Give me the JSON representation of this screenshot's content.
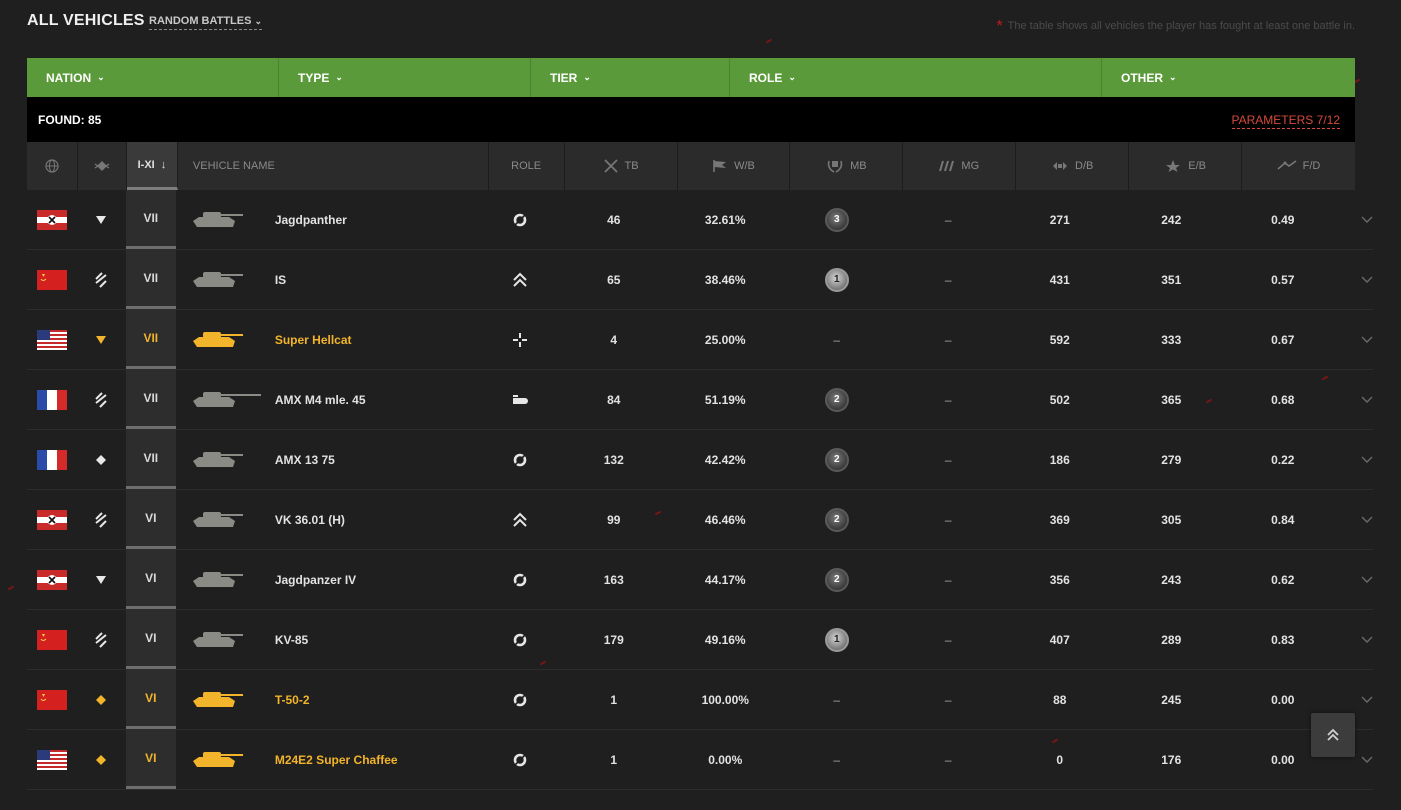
{
  "header": {
    "title": "ALL VEHICLES",
    "mode": "RANDOM BATTLES",
    "note": "The table shows all vehicles the player has fought at least one battle in."
  },
  "filters": [
    {
      "label": "NATION"
    },
    {
      "label": "TYPE"
    },
    {
      "label": "TIER"
    },
    {
      "label": "ROLE"
    },
    {
      "label": "OTHER"
    }
  ],
  "found": {
    "label": "FOUND: 85"
  },
  "params": {
    "label": "PARAMETERS 7/12"
  },
  "columns": {
    "tier": "I-XI",
    "name": "VEHICLE NAME",
    "role": "ROLE",
    "tb": "TB",
    "wb": "W/B",
    "mb": "MB",
    "mg": "MG",
    "db": "D/B",
    "eb": "E/B",
    "fd": "F/D"
  },
  "colors": {
    "filter_bar": "#5b9a3a",
    "premium": "#f2b42a",
    "params_link": "#d54a3a"
  },
  "rows": [
    {
      "nation": "germany",
      "type": "td-icon",
      "tier": "VII",
      "name": "Jagdpanther",
      "premium": false,
      "role": "sniper-role-icon",
      "tb": "46",
      "wb": "32.61%",
      "mb": "3",
      "mb_style": "bronze",
      "mg": "–",
      "db": "271",
      "eb": "242",
      "fd": "0.49"
    },
    {
      "nation": "ussr",
      "type": "heavy-icon",
      "tier": "VII",
      "name": "IS",
      "premium": false,
      "role": "assault-role-icon",
      "tb": "65",
      "wb": "38.46%",
      "mb": "1",
      "mb_style": "silver",
      "mg": "–",
      "db": "431",
      "eb": "351",
      "fd": "0.57"
    },
    {
      "nation": "usa",
      "type": "td-icon",
      "tier": "VII",
      "name": "Super Hellcat",
      "premium": true,
      "role": "crosshair-role-icon",
      "tb": "4",
      "wb": "25.00%",
      "mb": "–",
      "mb_style": "none",
      "mg": "–",
      "db": "592",
      "eb": "333",
      "fd": "0.67"
    },
    {
      "nation": "france",
      "type": "heavy-icon",
      "tier": "VII",
      "name": "AMX M4 mle. 45",
      "premium": false,
      "role": "support-role-icon",
      "tb": "84",
      "wb": "51.19%",
      "mb": "2",
      "mb_style": "bronze",
      "mg": "–",
      "db": "502",
      "eb": "365",
      "fd": "0.68"
    },
    {
      "nation": "france",
      "type": "light-icon",
      "tier": "VII",
      "name": "AMX 13 75",
      "premium": false,
      "role": "sniper-role-icon",
      "tb": "132",
      "wb": "42.42%",
      "mb": "2",
      "mb_style": "bronze",
      "mg": "–",
      "db": "186",
      "eb": "279",
      "fd": "0.22"
    },
    {
      "nation": "germany",
      "type": "heavy-icon",
      "tier": "VI",
      "name": "VK 36.01 (H)",
      "premium": false,
      "role": "assault-role-icon",
      "tb": "99",
      "wb": "46.46%",
      "mb": "2",
      "mb_style": "bronze",
      "mg": "–",
      "db": "369",
      "eb": "305",
      "fd": "0.84"
    },
    {
      "nation": "germany",
      "type": "td-icon",
      "tier": "VI",
      "name": "Jagdpanzer IV",
      "premium": false,
      "role": "sniper-role-icon",
      "tb": "163",
      "wb": "44.17%",
      "mb": "2",
      "mb_style": "bronze",
      "mg": "–",
      "db": "356",
      "eb": "243",
      "fd": "0.62"
    },
    {
      "nation": "ussr",
      "type": "heavy-icon",
      "tier": "VI",
      "name": "KV-85",
      "premium": false,
      "role": "sniper-role-icon",
      "tb": "179",
      "wb": "49.16%",
      "mb": "1",
      "mb_style": "silver",
      "mg": "–",
      "db": "407",
      "eb": "289",
      "fd": "0.83"
    },
    {
      "nation": "ussr",
      "type": "light-icon",
      "tier": "VI",
      "name": "T-50-2",
      "premium": true,
      "role": "sniper-role-icon",
      "tb": "1",
      "wb": "100.00%",
      "mb": "–",
      "mb_style": "none",
      "mg": "–",
      "db": "88",
      "eb": "245",
      "fd": "0.00"
    },
    {
      "nation": "usa",
      "type": "light-icon",
      "tier": "VI",
      "name": "M24E2 Super Chaffee",
      "premium": true,
      "role": "sniper-role-icon",
      "tb": "1",
      "wb": "0.00%",
      "mb": "–",
      "mb_style": "none",
      "mg": "–",
      "db": "0",
      "eb": "176",
      "fd": "0.00"
    }
  ]
}
